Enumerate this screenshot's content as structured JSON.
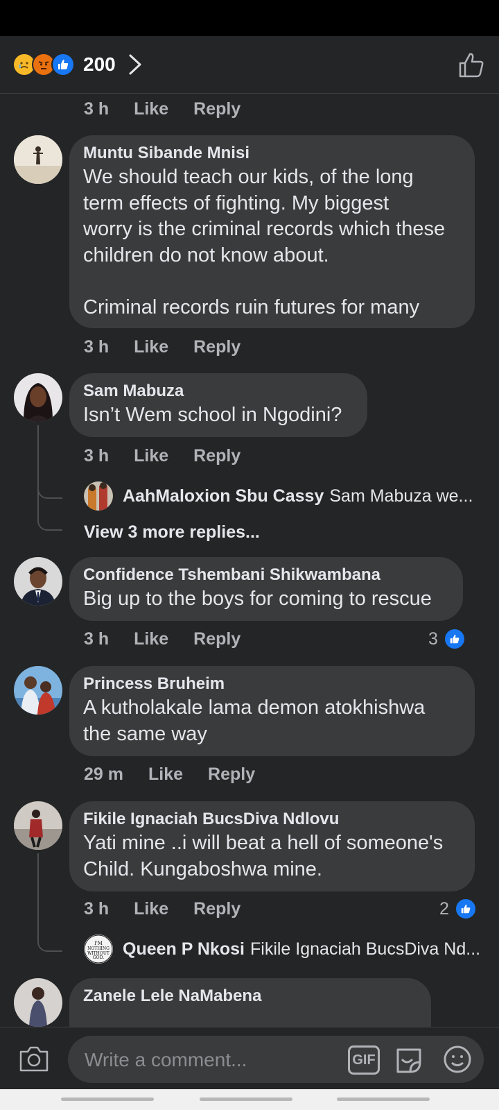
{
  "header": {
    "reactions": [
      "sad-emoji",
      "angry-emoji",
      "like-icon"
    ],
    "reaction_count": "200"
  },
  "first_meta": {
    "time": "3 h",
    "like": "Like",
    "reply": "Reply"
  },
  "comments": [
    {
      "name": "Muntu Sibande Mnisi",
      "text": "We should teach our kids, of the long\nterm effects of fighting. My biggest\nworry is the criminal records which these\nchildren do not know about.\n\nCriminal records ruin futures for many",
      "time": "3 h",
      "like": "Like",
      "reply": "Reply"
    },
    {
      "name": "Sam Mabuza",
      "text": "Isn’t Wem school in Ngodini?",
      "time": "3 h",
      "like": "Like",
      "reply": "Reply",
      "reply_preview": {
        "name": "AahMaloxion Sbu Cassy",
        "text": "Sam Mabuza we..."
      },
      "view_more": "View 3 more replies..."
    },
    {
      "name": "Confidence Tshembani Shikwambana",
      "text": "Big up to the boys for coming to rescue",
      "time": "3 h",
      "like": "Like",
      "reply": "Reply",
      "likes": "3"
    },
    {
      "name": "Princess Bruheim",
      "text": "A kutholakale lama demon atokhishwa\nthe same way",
      "time": "29 m",
      "like": "Like",
      "reply": "Reply"
    },
    {
      "name": "Fikile Ignaciah BucsDiva Ndlovu",
      "text": "Yati mine ..i will beat a hell of someone's\nChild. Kungaboshwa mine.",
      "time": "3 h",
      "like": "Like",
      "reply": "Reply",
      "likes": "2",
      "reply_preview": {
        "name": "Queen P Nkosi",
        "text": "Fikile Ignaciah BucsDiva Nd...",
        "avatar_text": "I'M NOTHING WITHOUT GOD."
      }
    },
    {
      "name": "Zanele Lele NaMabena"
    }
  ],
  "composer": {
    "placeholder": "Write a comment...",
    "gif_label": "GIF"
  },
  "colors": {
    "background": "#242526",
    "bubble": "#3a3b3c",
    "like_blue": "#1877f2",
    "meta_gray": "#b0b3b8"
  }
}
